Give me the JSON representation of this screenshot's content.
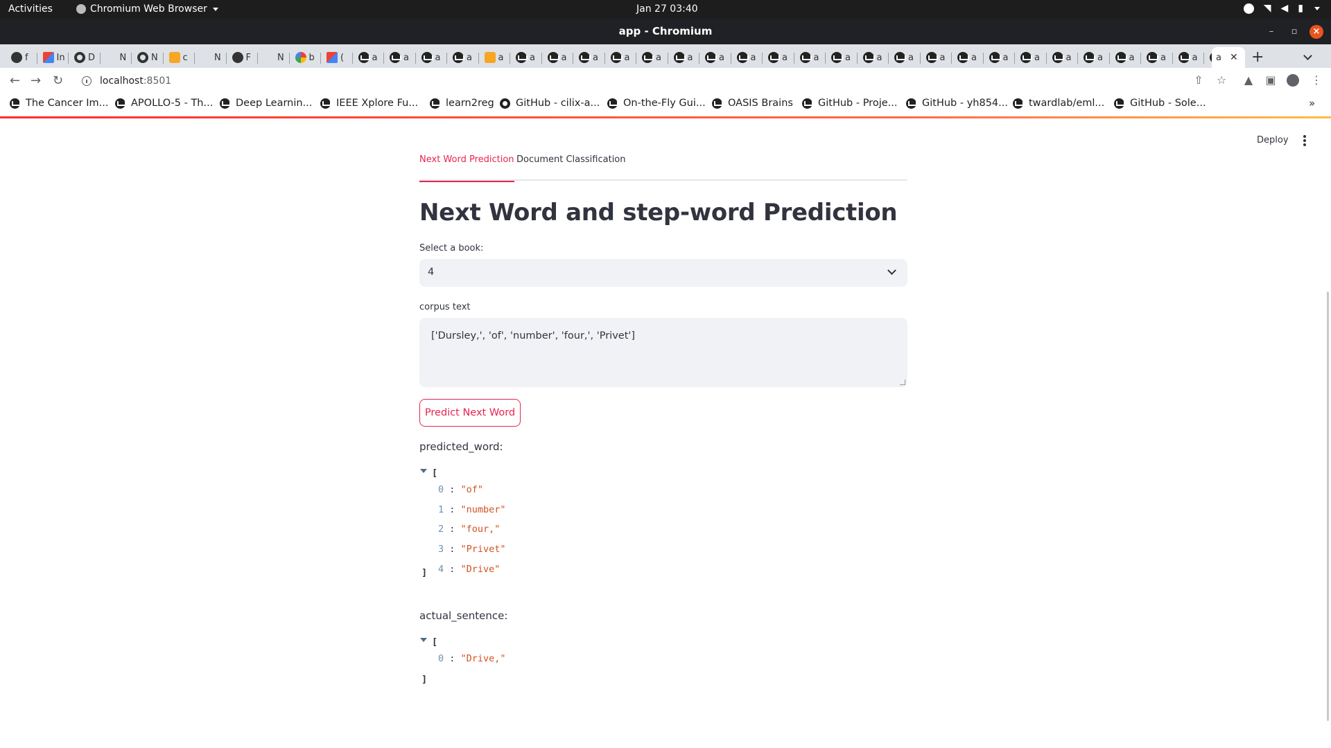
{
  "system_bar": {
    "activities": "Activities",
    "app_name": "Chromium Web Browser",
    "clock": "Jan 27  03:40"
  },
  "window": {
    "title": "app - Chromium"
  },
  "tabs": [
    {
      "icon": "globe",
      "text": "f"
    },
    {
      "icon": "gmail",
      "text": "In"
    },
    {
      "icon": "github",
      "text": "D"
    },
    {
      "icon": "blank",
      "text": "N"
    },
    {
      "icon": "github",
      "text": "N"
    },
    {
      "icon": "book",
      "text": "c"
    },
    {
      "icon": "blank",
      "text": "N"
    },
    {
      "icon": "gear",
      "text": "F"
    },
    {
      "icon": "blank",
      "text": "N"
    },
    {
      "icon": "google",
      "text": "b"
    },
    {
      "icon": "gmail",
      "text": "("
    },
    {
      "icon": "crown",
      "text": "a"
    },
    {
      "icon": "crown",
      "text": "a"
    },
    {
      "icon": "crown",
      "text": "a"
    },
    {
      "icon": "crown",
      "text": "a"
    },
    {
      "icon": "folder",
      "text": "a"
    },
    {
      "icon": "crown",
      "text": "a"
    },
    {
      "icon": "crown",
      "text": "a"
    },
    {
      "icon": "crown",
      "text": "a"
    },
    {
      "icon": "crown",
      "text": "a"
    },
    {
      "icon": "crown",
      "text": "a"
    },
    {
      "icon": "crown",
      "text": "a"
    },
    {
      "icon": "crown",
      "text": "a"
    },
    {
      "icon": "crown",
      "text": "a"
    },
    {
      "icon": "crown",
      "text": "a"
    },
    {
      "icon": "crown",
      "text": "a"
    },
    {
      "icon": "crown",
      "text": "a"
    },
    {
      "icon": "crown",
      "text": "a"
    },
    {
      "icon": "crown",
      "text": "a"
    },
    {
      "icon": "crown",
      "text": "a"
    },
    {
      "icon": "crown",
      "text": "a"
    },
    {
      "icon": "crown",
      "text": "a"
    },
    {
      "icon": "crown",
      "text": "a"
    },
    {
      "icon": "crown",
      "text": "a"
    },
    {
      "icon": "crown",
      "text": "a"
    },
    {
      "icon": "crown",
      "text": "a"
    },
    {
      "icon": "crown",
      "text": "a"
    },
    {
      "icon": "crown",
      "text": "a"
    },
    {
      "icon": "crown",
      "text": "a"
    }
  ],
  "active_tab_text": "a",
  "address": {
    "host": "localhost",
    "port": ":8501"
  },
  "bookmarks": [
    "The Cancer Im...",
    "APOLLO-5 - Th...",
    "Deep Learnin...",
    "IEEE Xplore Fu...",
    "learn2reg",
    "GitHub - cilix-a...",
    "On-the-Fly Gui...",
    "OASIS Brains",
    "GitHub - Proje...",
    "GitHub - yh854...",
    "twardlab/eml...",
    "GitHub - Sole..."
  ],
  "app": {
    "deploy_label": "Deploy",
    "tabs": [
      "Next Word Prediction",
      "Document Classification"
    ],
    "title": "Next Word and step-word Prediction",
    "select_label": "Select a book:",
    "select_value": "4",
    "corpus_label": "corpus text",
    "corpus_value": "['Dursley,', 'of', 'number', 'four,', 'Privet']",
    "predict_button": "Predict Next Word",
    "predicted_label": "predicted_word:",
    "predicted": [
      "\"of\"",
      "\"number\"",
      "\"four,\"",
      "\"Privet\"",
      "\"Drive\""
    ],
    "actual_label": "actual_sentence:",
    "actual": [
      "\"Drive,\""
    ]
  },
  "colors": {
    "accent": "#e8254e",
    "input_bg": "#f0f2f6",
    "json_string": "#d4511f"
  }
}
